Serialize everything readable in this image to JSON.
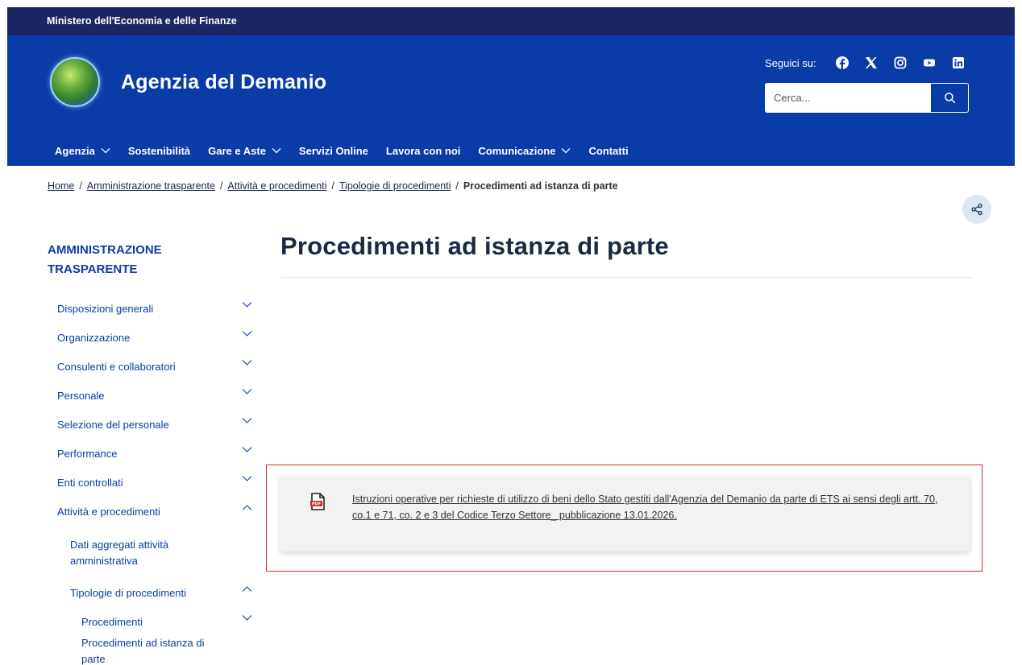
{
  "topbar": {
    "text": "Ministero dell'Economia e delle Finanze"
  },
  "header": {
    "site_name": "Agenzia del Demanio",
    "follow_label": "Seguici su:",
    "social_icons": [
      "facebook-icon",
      "x-icon",
      "instagram-icon",
      "youtube-icon",
      "linkedin-icon"
    ],
    "search_placeholder": "Cerca..."
  },
  "nav": [
    {
      "label": "Agenzia",
      "dropdown": true
    },
    {
      "label": "Sostenibilità",
      "dropdown": false
    },
    {
      "label": "Gare e Aste",
      "dropdown": true
    },
    {
      "label": "Servizi Online",
      "dropdown": false
    },
    {
      "label": "Lavora con noi",
      "dropdown": false
    },
    {
      "label": "Comunicazione",
      "dropdown": true
    },
    {
      "label": "Contatti",
      "dropdown": false
    }
  ],
  "breadcrumb": {
    "links": [
      "Home",
      "Amministrazione trasparente",
      "Attività e procedimenti",
      "Tipologie di procedimenti"
    ],
    "current": "Procedimenti ad istanza di parte"
  },
  "sidebar": {
    "title": "AMMINISTRAZIONE TRASPARENTE",
    "items": [
      {
        "label": "Disposizioni generali",
        "chevron": "down"
      },
      {
        "label": "Organizzazione",
        "chevron": "down"
      },
      {
        "label": "Consulenti e collaboratori",
        "chevron": "down"
      },
      {
        "label": "Personale",
        "chevron": "down"
      },
      {
        "label": "Selezione del personale",
        "chevron": "down"
      },
      {
        "label": "Performance",
        "chevron": "down"
      },
      {
        "label": "Enti controllati",
        "chevron": "down"
      },
      {
        "label": "Attività e procedimenti",
        "chevron": "up"
      },
      {
        "label": "Dati aggregati attività amministrativa",
        "chevron": "none"
      },
      {
        "label": "Tipologie di procedimenti",
        "chevron": "up"
      },
      {
        "label": "Procedimenti",
        "chevron": "down"
      },
      {
        "label": "Procedimenti ad istanza di parte",
        "chevron": "none"
      }
    ]
  },
  "main": {
    "title": "Procedimenti ad istanza di parte",
    "document": {
      "icon": "pdf-icon",
      "link_text": "Istruzioni operative per richieste di utilizzo di beni dello Stato gestiti dall'Agenzia del Demanio da parte di ETS ai sensi degli artt. 70, co.1 e 71, co. 2 e 3 del Codice Terzo Settore_ pubblicazione 13.01.2026."
    }
  },
  "colors": {
    "topbar": "#1c2563",
    "header": "#0a3ca8",
    "text_dark": "#1a2a44",
    "accent_link": "#0a3ca8",
    "highlight_border": "#d62c2c"
  }
}
